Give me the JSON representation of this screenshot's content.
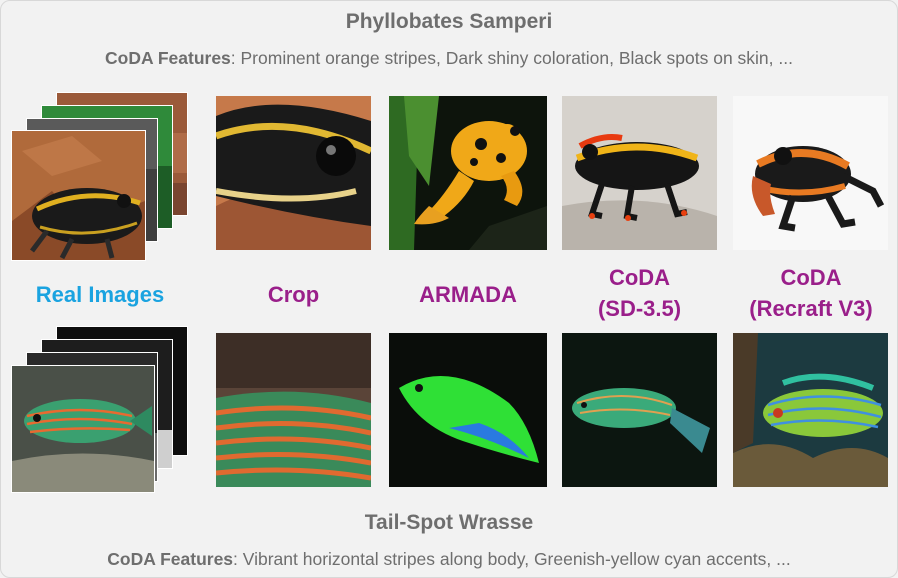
{
  "top": {
    "species": "Phyllobates Samperi",
    "features_label": "CoDA Features",
    "features_text": ": Prominent orange stripes, Dark shiny coloration, Black spots on skin, ..."
  },
  "bottom": {
    "species": "Tail-Spot Wrasse",
    "features_label": "CoDA Features",
    "features_text": ": Vibrant horizontal stripes along body, Greenish-yellow cyan accents, ..."
  },
  "columns": {
    "real": "Real Images",
    "crop": "Crop",
    "armada": "ARMADA",
    "coda_sd_line1": "CoDA",
    "coda_sd_line2": "(SD-3.5)",
    "coda_recraft_line1": "CoDA",
    "coda_recraft_line2": "(Recraft V3)"
  }
}
